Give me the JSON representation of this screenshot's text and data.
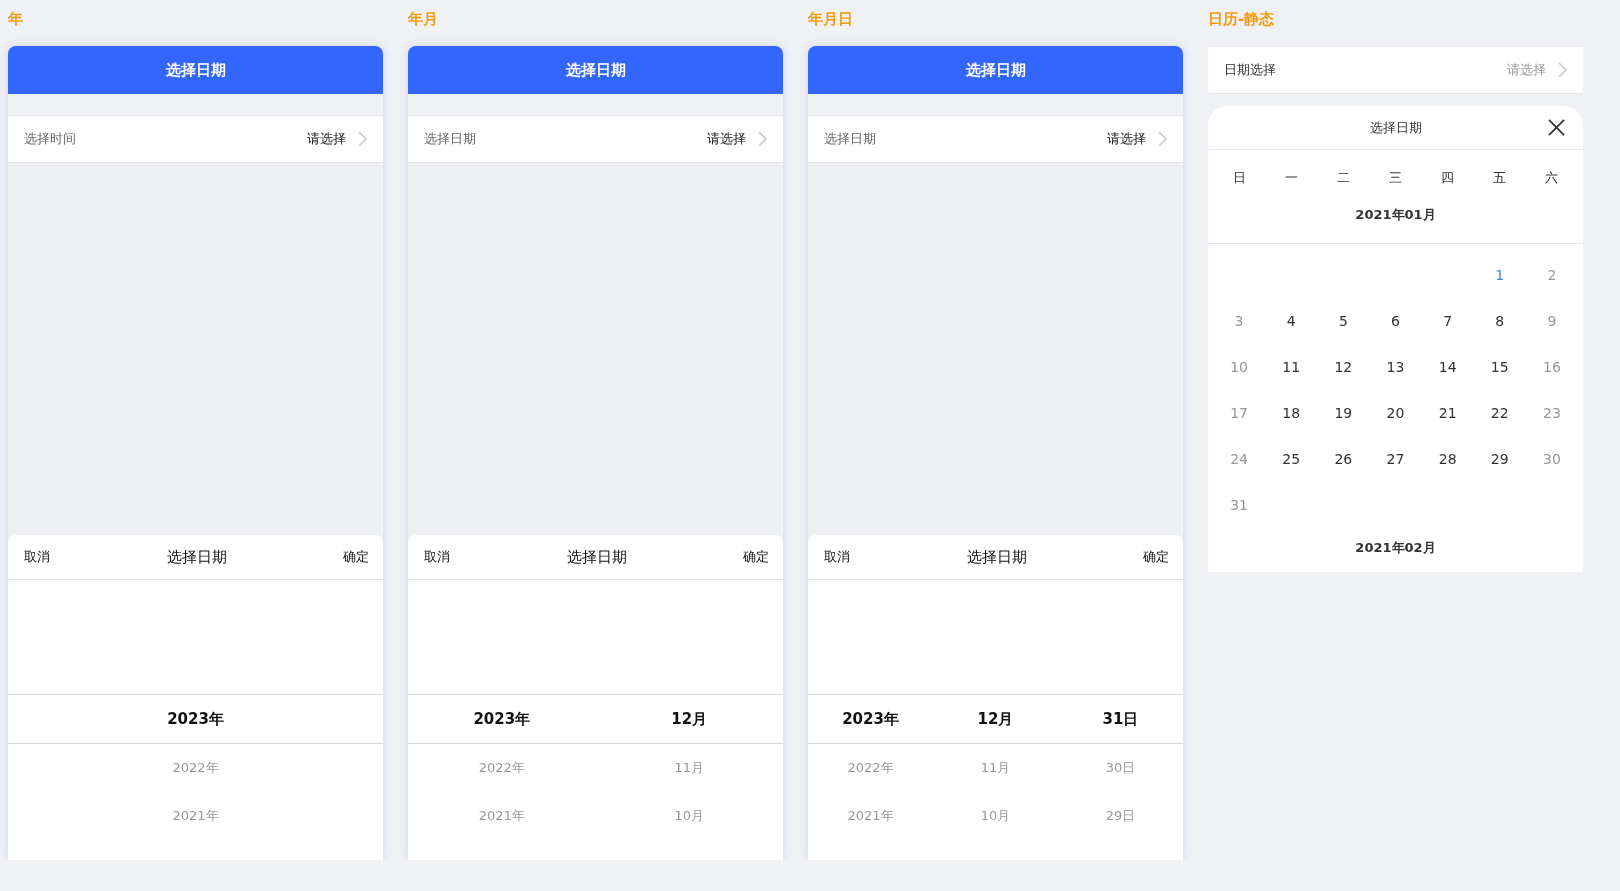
{
  "demos": [
    {
      "title": "年",
      "header": "选择日期",
      "field": {
        "label": "选择时间",
        "value": "请选择",
        "muted": false
      },
      "picker": {
        "cancel": "取消",
        "title": "选择日期",
        "confirm": "确定",
        "columns": [
          {
            "options": [
              {
                "label": "2023年",
                "selected": true
              },
              {
                "label": "2022年",
                "selected": false
              },
              {
                "label": "2021年",
                "selected": false
              }
            ]
          }
        ]
      }
    },
    {
      "title": "年月",
      "header": "选择日期",
      "field": {
        "label": "选择日期",
        "value": "请选择",
        "muted": false
      },
      "picker": {
        "cancel": "取消",
        "title": "选择日期",
        "confirm": "确定",
        "columns": [
          {
            "options": [
              {
                "label": "2023年",
                "selected": true
              },
              {
                "label": "2022年",
                "selected": false
              },
              {
                "label": "2021年",
                "selected": false
              }
            ]
          },
          {
            "options": [
              {
                "label": "12月",
                "selected": true
              },
              {
                "label": "11月",
                "selected": false
              },
              {
                "label": "10月",
                "selected": false
              }
            ]
          }
        ]
      }
    },
    {
      "title": "年月日",
      "header": "选择日期",
      "field": {
        "label": "选择日期",
        "value": "请选择",
        "muted": false
      },
      "picker": {
        "cancel": "取消",
        "title": "选择日期",
        "confirm": "确定",
        "columns": [
          {
            "options": [
              {
                "label": "2023年",
                "selected": true
              },
              {
                "label": "2022年",
                "selected": false
              },
              {
                "label": "2021年",
                "selected": false
              }
            ]
          },
          {
            "options": [
              {
                "label": "12月",
                "selected": true
              },
              {
                "label": "11月",
                "selected": false
              },
              {
                "label": "10月",
                "selected": false
              }
            ]
          },
          {
            "options": [
              {
                "label": "31日",
                "selected": true
              },
              {
                "label": "30日",
                "selected": false
              },
              {
                "label": "29日",
                "selected": false
              }
            ]
          }
        ]
      }
    }
  ],
  "calendar_demo": {
    "title": "日历-静态",
    "field": {
      "label": "日期选择",
      "value": "请选择",
      "muted": true
    },
    "calendar": {
      "title": "选择日期",
      "weekdays": [
        "日",
        "一",
        "二",
        "三",
        "四",
        "五",
        "六"
      ],
      "months": [
        {
          "label": "2021年01月",
          "weeks": [
            {
              "days": [
                {
                  "label": "1",
                  "selected": true,
                  "weekend": false
                },
                {
                  "label": "2",
                  "selected": false,
                  "weekend": true
                }
              ]
            },
            {
              "days": [
                {
                  "label": "3",
                  "selected": false,
                  "weekend": true
                },
                {
                  "label": "4",
                  "selected": false,
                  "weekend": false
                },
                {
                  "label": "5",
                  "selected": false,
                  "weekend": false
                },
                {
                  "label": "6",
                  "selected": false,
                  "weekend": false
                },
                {
                  "label": "7",
                  "selected": false,
                  "weekend": false
                },
                {
                  "label": "8",
                  "selected": false,
                  "weekend": false
                },
                {
                  "label": "9",
                  "selected": false,
                  "weekend": true
                }
              ]
            },
            {
              "days": [
                {
                  "label": "10",
                  "selected": false,
                  "weekend": true
                },
                {
                  "label": "11",
                  "selected": false,
                  "weekend": false
                },
                {
                  "label": "12",
                  "selected": false,
                  "weekend": false
                },
                {
                  "label": "13",
                  "selected": false,
                  "weekend": false
                },
                {
                  "label": "14",
                  "selected": false,
                  "weekend": false
                },
                {
                  "label": "15",
                  "selected": false,
                  "weekend": false
                },
                {
                  "label": "16",
                  "selected": false,
                  "weekend": true
                }
              ]
            },
            {
              "days": [
                {
                  "label": "17",
                  "selected": false,
                  "weekend": true
                },
                {
                  "label": "18",
                  "selected": false,
                  "weekend": false
                },
                {
                  "label": "19",
                  "selected": false,
                  "weekend": false
                },
                {
                  "label": "20",
                  "selected": false,
                  "weekend": false
                },
                {
                  "label": "21",
                  "selected": false,
                  "weekend": false
                },
                {
                  "label": "22",
                  "selected": false,
                  "weekend": false
                },
                {
                  "label": "23",
                  "selected": false,
                  "weekend": true
                }
              ]
            },
            {
              "days": [
                {
                  "label": "24",
                  "selected": false,
                  "weekend": true
                },
                {
                  "label": "25",
                  "selected": false,
                  "weekend": false
                },
                {
                  "label": "26",
                  "selected": false,
                  "weekend": false
                },
                {
                  "label": "27",
                  "selected": false,
                  "weekend": false
                },
                {
                  "label": "28",
                  "selected": false,
                  "weekend": false
                },
                {
                  "label": "29",
                  "selected": false,
                  "weekend": false
                },
                {
                  "label": "30",
                  "selected": false,
                  "weekend": true
                }
              ]
            },
            {
              "days": [
                {
                  "label": "31",
                  "selected": false,
                  "weekend": true
                }
              ]
            }
          ]
        },
        {
          "label": "2021年02月"
        }
      ]
    }
  }
}
